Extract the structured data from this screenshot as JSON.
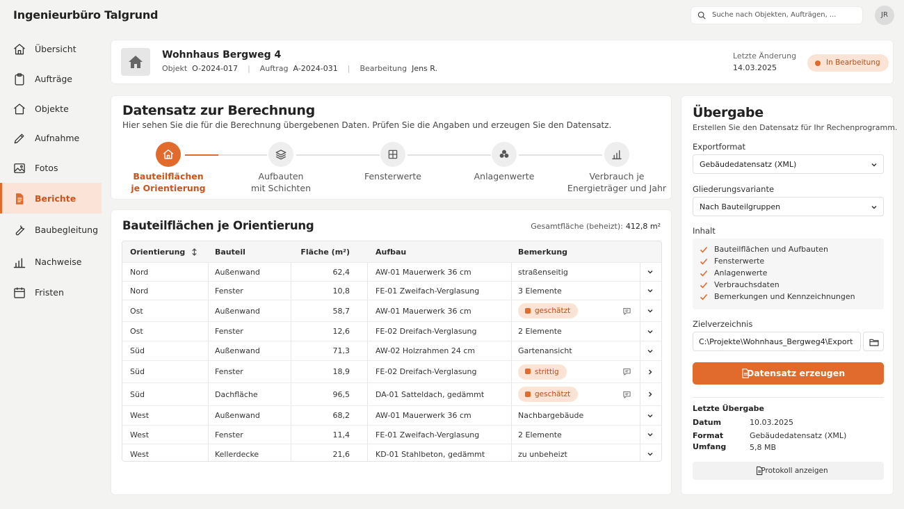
{
  "app": {
    "title": "Ingenieurbüro Talgrund"
  },
  "search": {
    "placeholder": "Suche nach Objekten, Aufträgen, ..."
  },
  "user": {
    "initials": "JR"
  },
  "sidebar": {
    "items": [
      {
        "label": "Übersicht",
        "icon": "home-icon"
      },
      {
        "label": "Aufträge",
        "icon": "clipboard-icon"
      },
      {
        "label": "Objekte",
        "icon": "house-icon"
      },
      {
        "label": "Aufnahme",
        "icon": "pencil-icon"
      },
      {
        "label": "Fotos",
        "icon": "image-icon"
      },
      {
        "label": "Berichte",
        "icon": "document-icon",
        "active": true
      },
      {
        "label": "Baubegleitung",
        "icon": "wrench-icon"
      },
      {
        "label": "Nachweise",
        "icon": "bar-chart-icon"
      },
      {
        "label": "Fristen",
        "icon": "calendar-icon"
      }
    ]
  },
  "header": {
    "title": "Wohnhaus Bergweg 4",
    "object_label": "Objekt",
    "object_value": "O-2024-017",
    "order_label": "Auftrag",
    "order_value": "A-2024-031",
    "editor_label": "Bearbeitung",
    "editor_value": "Jens R.",
    "last_change_label": "Letzte Änderung",
    "last_change_value": "14.03.2025",
    "status": "In Bearbeitung"
  },
  "stepper": {
    "title": "Datensatz zur Berechnung",
    "subtitle": "Hier sehen Sie die für die Berechnung übergebenen Daten. Prüfen Sie die Angaben und erzeugen Sie den Datensatz.",
    "steps": [
      {
        "line1": "Bauteilflächen",
        "line2": "je Orientierung",
        "icon": "house-icon",
        "active": true
      },
      {
        "line1": "Aufbauten",
        "line2": "mit Schichten",
        "icon": "layers-icon"
      },
      {
        "line1": "Fensterwerte",
        "line2": "",
        "icon": "window-icon"
      },
      {
        "line1": "Anlagenwerte",
        "line2": "",
        "icon": "fan-icon"
      },
      {
        "line1": "Verbrauch je",
        "line2": "Energieträger und Jahr",
        "icon": "bar-chart-icon"
      }
    ]
  },
  "table": {
    "title": "Bauteilflächen je Orientierung",
    "total_label": "Gesamtfläche (beheizt):",
    "total_value": "412,8 m²",
    "columns": {
      "orientation": "Orientierung",
      "component": "Bauteil",
      "area": "Fläche (m²)",
      "construction": "Aufbau",
      "remark": "Bemerkung"
    },
    "rows": [
      {
        "orientation": "Nord",
        "component": "Außenwand",
        "area": "62,4",
        "construction": "AW-01 Mauerwerk 36 cm",
        "remark": "straßenseitig",
        "badge": false,
        "note": false,
        "action": "chevron-down"
      },
      {
        "orientation": "Nord",
        "component": "Fenster",
        "area": "10,8",
        "construction": "FE-01 Zweifach-Verglasung",
        "remark": "3 Elemente",
        "badge": false,
        "note": false,
        "action": "chevron-down"
      },
      {
        "orientation": "Ost",
        "component": "Außenwand",
        "area": "58,7",
        "construction": "AW-01 Mauerwerk 36 cm",
        "remark": "geschätzt",
        "badge": true,
        "note": true,
        "action": "chevron-down"
      },
      {
        "orientation": "Ost",
        "component": "Fenster",
        "area": "12,6",
        "construction": "FE-02 Dreifach-Verglasung",
        "remark": "2 Elemente",
        "badge": false,
        "note": false,
        "action": "chevron-down"
      },
      {
        "orientation": "Süd",
        "component": "Außenwand",
        "area": "71,3",
        "construction": "AW-02 Holzrahmen 24 cm",
        "remark": "Gartenansicht",
        "badge": false,
        "note": false,
        "action": "chevron-down"
      },
      {
        "orientation": "Süd",
        "component": "Fenster",
        "area": "18,9",
        "construction": "FE-02 Dreifach-Verglasung",
        "remark": "strittig",
        "badge": true,
        "note": true,
        "action": "chevron-right"
      },
      {
        "orientation": "Süd",
        "component": "Dachfläche",
        "area": "96,5",
        "construction": "DA-01 Satteldach, gedämmt",
        "remark": "geschätzt",
        "badge": true,
        "note": true,
        "action": "chevron-right"
      },
      {
        "orientation": "West",
        "component": "Außenwand",
        "area": "68,2",
        "construction": "AW-01 Mauerwerk 36 cm",
        "remark": "Nachbargebäude",
        "badge": false,
        "note": false,
        "action": "chevron-down"
      },
      {
        "orientation": "West",
        "component": "Fenster",
        "area": "11,4",
        "construction": "FE-01 Zweifach-Verglasung",
        "remark": "2 Elemente",
        "badge": false,
        "note": false,
        "action": "chevron-down"
      },
      {
        "orientation": "West",
        "component": "Kellerdecke",
        "area": "21,6",
        "construction": "KD-01 Stahlbeton, gedämmt",
        "remark": "zu unbeheizt",
        "badge": false,
        "note": false,
        "action": "chevron-down"
      }
    ]
  },
  "export": {
    "title": "Übergabe",
    "subtitle": "Erstellen Sie den Datensatz für Ihr Rechenprogramm.",
    "format_label": "Exportformat",
    "format_value": "Gebäudedatensatz (XML)",
    "structure_label": "Gliederungsvariante",
    "structure_value": "Nach Bauteilgruppen",
    "content_label": "Inhalt",
    "content_items": [
      "Bauteilflächen und Aufbauten",
      "Fensterwerte",
      "Anlagenwerte",
      "Verbrauchsdaten",
      "Bemerkungen und Kennzeichnungen"
    ],
    "target_label": "Zielverzeichnis",
    "target_value": "C:\\Projekte\\Wohnhaus_Bergweg4\\Export",
    "generate_label": "Datensatz erzeugen",
    "last_title": "Letzte Übergabe",
    "last_date_label": "Datum",
    "last_date_value": "10.03.2025",
    "last_format_label": "Format",
    "last_format_value": "Gebäudedatensatz (XML)",
    "last_size_label": "Umfang",
    "last_size_value": "5,8 MB",
    "protocol_label": "Protokoll anzeigen"
  },
  "colors": {
    "accent": "#e16a2d",
    "accent_light": "#fbe3d5",
    "background": "#f3f3f2"
  }
}
